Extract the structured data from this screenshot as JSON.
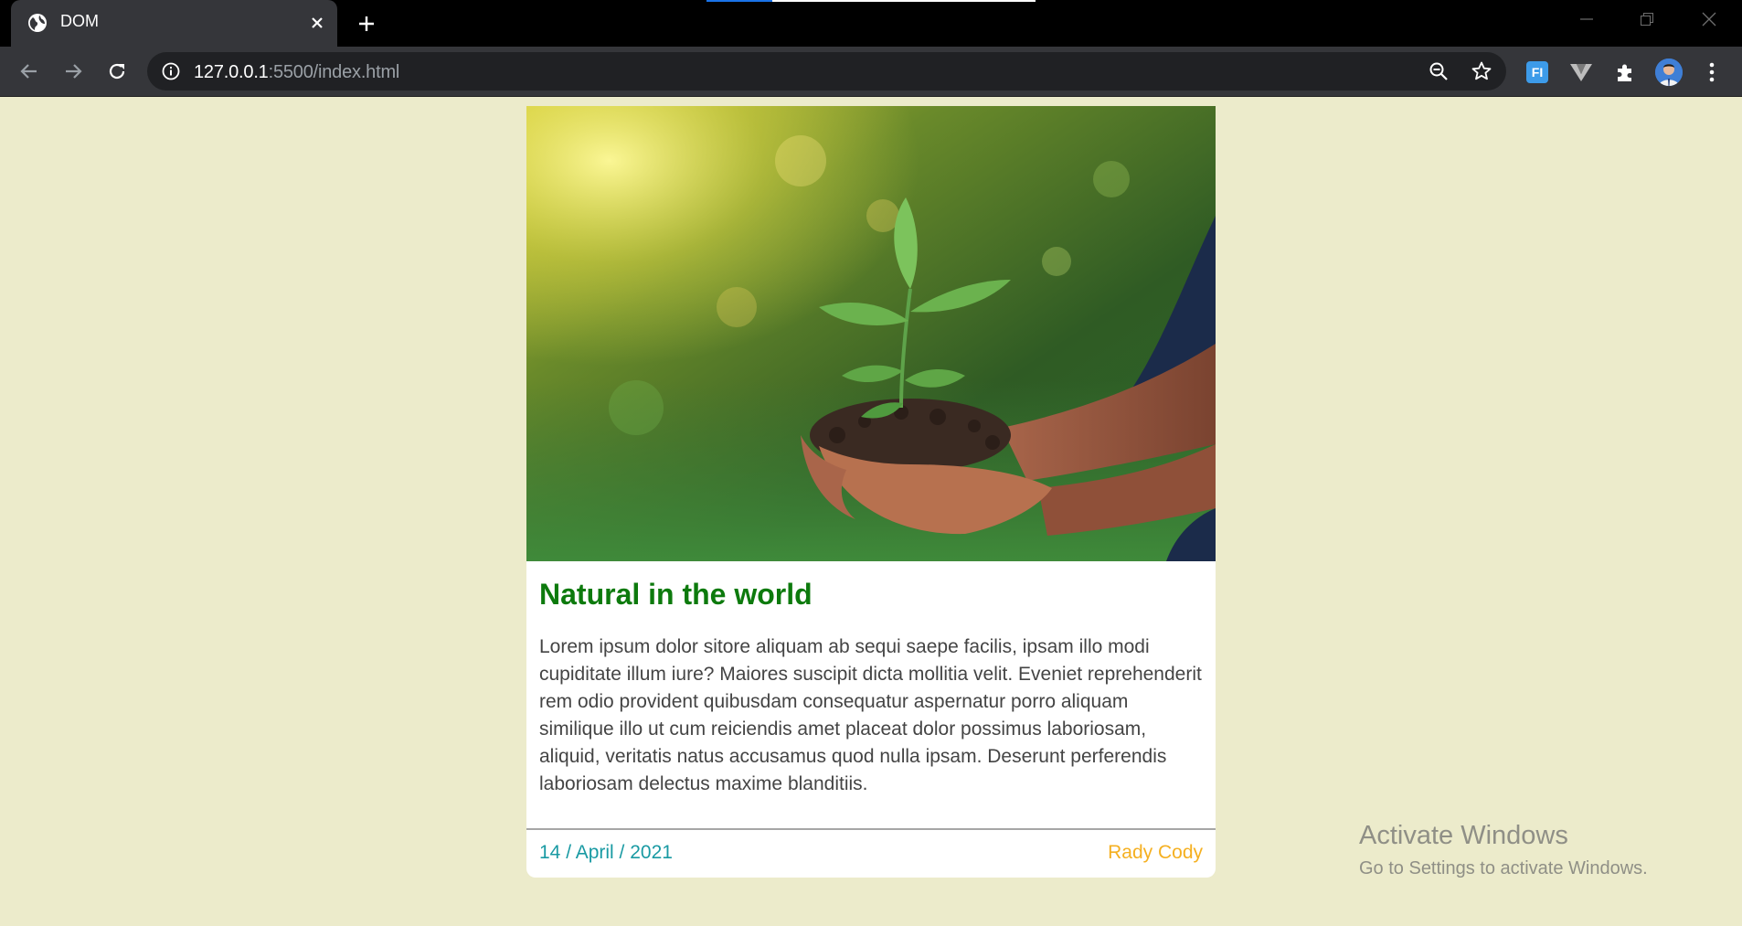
{
  "tab": {
    "title": "DOM"
  },
  "address_bar": {
    "host": "127.0.0.1",
    "rest": ":5500/index.html"
  },
  "icons": {
    "favicon": "globe-icon",
    "close": "close-icon",
    "new_tab": "plus-icon",
    "back": "arrow-left-icon",
    "forward": "arrow-right-icon",
    "reload": "reload-icon",
    "info": "info-icon",
    "zoom": "zoom-out-icon",
    "bookmark": "star-icon",
    "extensions": "puzzle-icon",
    "menu": "kebab-menu-icon"
  },
  "extensions": {
    "fi_label": "FI"
  },
  "card": {
    "title": "Natural in the world",
    "body": "Lorem ipsum dolor sitore aliquam ab sequi saepe facilis, ipsam illo modi cupiditate illum iure? Maiores suscipit dicta mollitia velit. Eveniet reprehenderit rem odio provident quibusdam consequatur aspernatur porro aliquam similique illo ut cum reiciendis amet placeat dolor possimus laboriosam, aliquid, veritatis natus accusamus quod nulla ipsam. Deserunt perferendis laboriosam delectus maxime blanditiis.",
    "date": "14 / April / 2021",
    "author": "Rady Cody"
  },
  "watermark": {
    "title": "Activate Windows",
    "subtitle": "Go to Settings to activate Windows."
  },
  "colors": {
    "page_background": "#ecebcb",
    "title": "#0d7a0d",
    "date": "#199aa3",
    "author": "#f5b021"
  }
}
